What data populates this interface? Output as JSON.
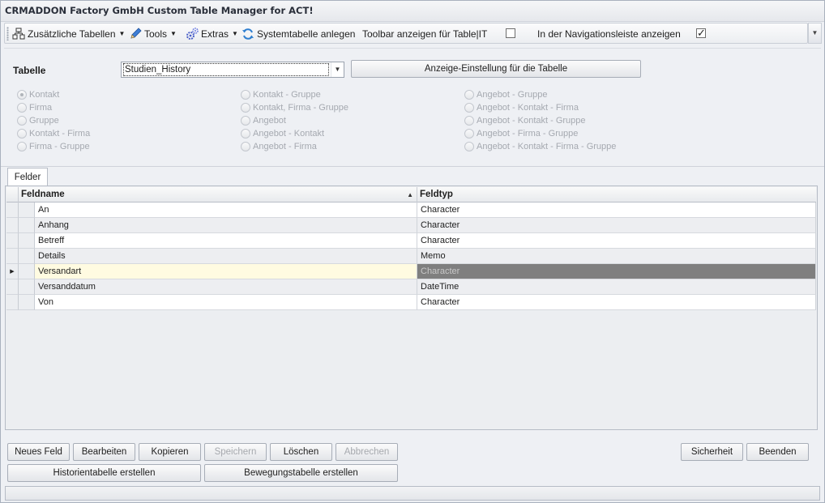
{
  "window": {
    "title": "CRMADDON Factory GmbH Custom Table Manager for ACT!"
  },
  "toolbar": {
    "items": [
      {
        "label": "Zusätzliche Tabellen",
        "icon": "table-icon",
        "dropdown": true
      },
      {
        "label": "Tools",
        "icon": "pencil-icon",
        "dropdown": true
      },
      {
        "label": "Extras",
        "icon": "gears-icon",
        "dropdown": true
      },
      {
        "label": "Systemtabelle anlegen",
        "icon": "refresh-icon",
        "dropdown": false
      }
    ],
    "toolbar_label": "Toolbar anzeigen für Table|IT",
    "toolbar_checked": false,
    "navigation_label": "In der Navigationsleiste anzeigen",
    "navigation_checked": true
  },
  "table_selector": {
    "label": "Tabelle",
    "selected": "Studien_History",
    "settings_button": "Anzeige-Einstellung für die Tabelle"
  },
  "radio_options": {
    "col1": [
      "Kontakt",
      "Firma",
      "Gruppe",
      "Kontakt - Firma",
      "Firma - Gruppe"
    ],
    "col2": [
      "Kontakt - Gruppe",
      "Kontakt, Firma - Gruppe",
      "Angebot",
      "Angebot - Kontakt",
      "Angebot - Firma"
    ],
    "col3": [
      "Angebot - Gruppe",
      "Angebot - Kontakt - Firma",
      "Angebot - Kontakt - Gruppe",
      "Angebot - Firma - Gruppe",
      "Angebot - Kontakt - Firma - Gruppe"
    ],
    "selected": "Kontakt"
  },
  "tabs": [
    {
      "label": "Felder"
    }
  ],
  "grid": {
    "columns": [
      "Feldname",
      "Feldtyp"
    ],
    "rows": [
      {
        "name": "An",
        "type": "Character"
      },
      {
        "name": "Anhang",
        "type": "Character"
      },
      {
        "name": "Betreff",
        "type": "Character"
      },
      {
        "name": "Details",
        "type": "Memo"
      },
      {
        "name": "Versandart",
        "type": "Character"
      },
      {
        "name": "Versanddatum",
        "type": "DateTime"
      },
      {
        "name": "Von",
        "type": "Character"
      }
    ],
    "focused_row": 4
  },
  "buttons": {
    "new_field": "Neues Feld",
    "edit": "Bearbeiten",
    "copy": "Kopieren",
    "save": "Speichern",
    "delete": "Löschen",
    "cancel": "Abbrechen",
    "backup": "Sicherheit",
    "exit": "Beenden",
    "history_table": "Historientabelle erstellen",
    "movement_table": "Bewegungstabelle erstellen"
  },
  "colors": {
    "focused_cell_bg": "#fffbe1",
    "selected_cell_bg": "#7f7f7f",
    "disabled_text": "#a5a9b0"
  }
}
